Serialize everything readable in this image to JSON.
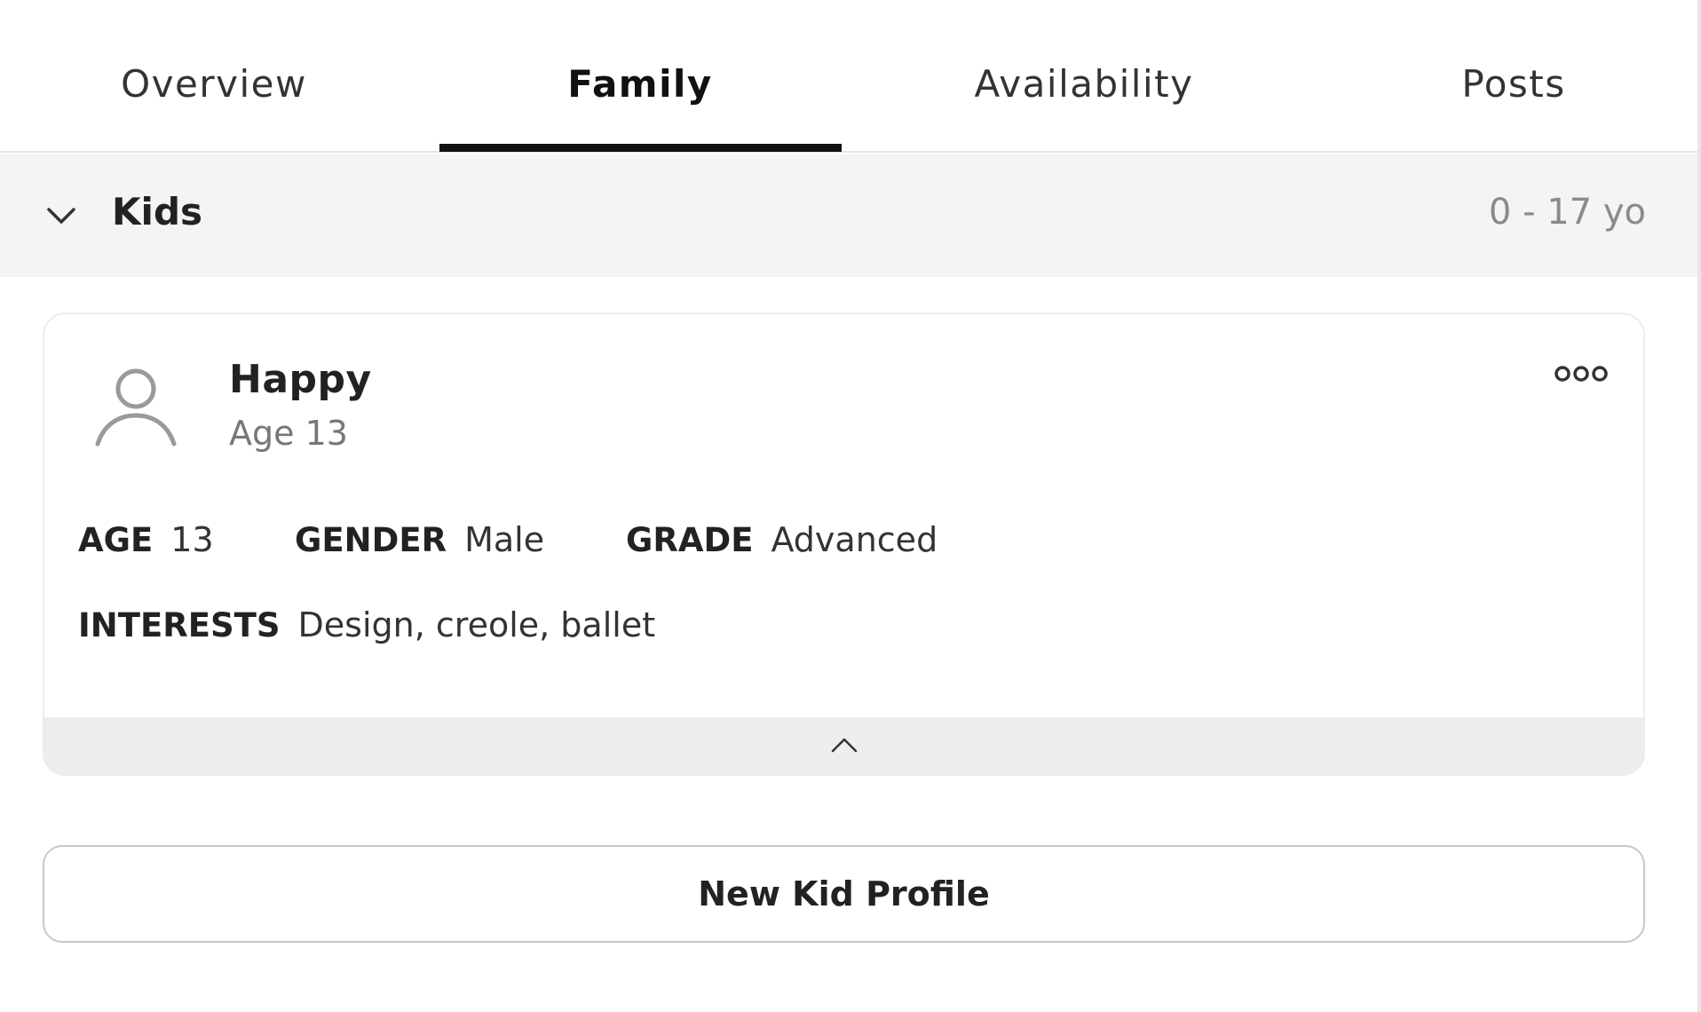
{
  "tabs": [
    {
      "label": "Overview",
      "active": false
    },
    {
      "label": "Family",
      "active": true
    },
    {
      "label": "Availability",
      "active": false
    },
    {
      "label": "Posts",
      "active": false
    }
  ],
  "section": {
    "title": "Kids",
    "range": "0 - 17 yo",
    "expanded": true
  },
  "kid": {
    "name": "Happy",
    "subtitle": "Age 13",
    "fields": {
      "age_label": "AGE",
      "age_value": "13",
      "gender_label": "GENDER",
      "gender_value": "Male",
      "grade_label": "GRADE",
      "grade_value": "Advanced",
      "interests_label": "INTERESTS",
      "interests_value": "Design, creole, ballet"
    }
  },
  "new_button_label": "New Kid Profile",
  "icons": {
    "section_toggle": "chevron-down-icon",
    "avatar": "user-silhouette-icon",
    "more": "more-options-icon",
    "collapse": "chevron-up-icon"
  },
  "colors": {
    "active_tab_underline": "#111111",
    "section_bg": "#f4f4f4",
    "muted_text": "#8a8a8a"
  }
}
